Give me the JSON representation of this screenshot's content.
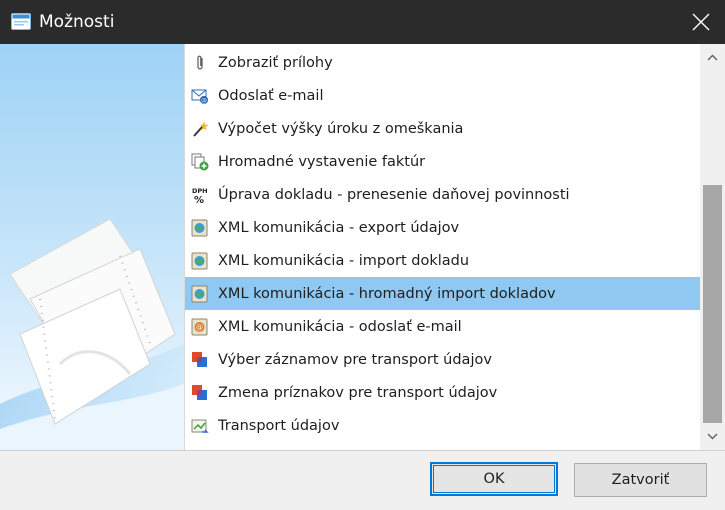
{
  "window": {
    "title": "Možnosti"
  },
  "items": [
    {
      "label": "Zobraziť prílohy",
      "icon": "paperclip-icon"
    },
    {
      "label": "Odoslať e-mail",
      "icon": "email-icon"
    },
    {
      "label": "Výpočet výšky úroku z omeškania",
      "icon": "wand-icon"
    },
    {
      "label": "Hromadné vystavenie faktúr",
      "icon": "invoices-add-icon"
    },
    {
      "label": "Úprava dokladu - prenesenie daňovej povinnosti",
      "icon": "vat-percent-icon"
    },
    {
      "label": "XML komunikácia - export údajov",
      "icon": "xml-globe-icon"
    },
    {
      "label": "XML komunikácia - import dokladu",
      "icon": "xml-globe-icon"
    },
    {
      "label": "XML komunikácia - hromadný import dokladov",
      "icon": "xml-globe-icon",
      "selected": true
    },
    {
      "label": "XML komunikácia - odoslať e-mail",
      "icon": "xml-email-icon"
    },
    {
      "label": "Výber záznamov pre transport údajov",
      "icon": "transport-select-icon"
    },
    {
      "label": "Zmena príznakov pre transport údajov",
      "icon": "transport-flags-icon"
    },
    {
      "label": "Transport údajov",
      "icon": "transport-icon"
    }
  ],
  "buttons": {
    "ok": "OK",
    "close": "Zatvoriť"
  },
  "colors": {
    "titlebar": "#2b2b2b",
    "selection": "#8fc9f2",
    "accent": "#0078d7"
  }
}
